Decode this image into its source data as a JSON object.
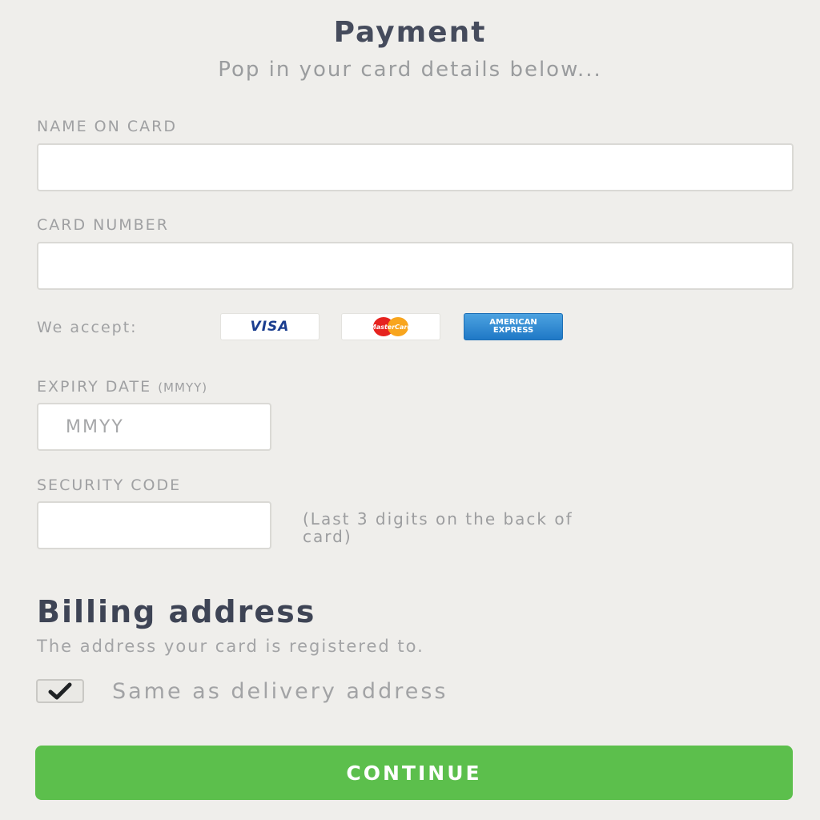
{
  "header": {
    "title": "Payment",
    "subtitle": "Pop in your card details below..."
  },
  "form": {
    "name_label": "NAME ON CARD",
    "name_value": "",
    "card_number_label": "CARD NUMBER",
    "card_number_value": "",
    "accept_label": "We accept:",
    "cards": {
      "visa": "VISA",
      "mastercard": "MasterCard",
      "amex_line1": "AMERICAN",
      "amex_line2": "EXPRESS"
    },
    "expiry_label": "EXPIRY DATE",
    "expiry_format": "(MMYY)",
    "expiry_placeholder": "MMYY",
    "security_label": "SECURITY CODE",
    "security_value": "",
    "security_hint": "(Last 3 digits on the back of card)"
  },
  "billing": {
    "title": "Billing address",
    "subtitle": "The address your card is registered to.",
    "same_as_delivery_label": "Same as delivery address",
    "same_as_delivery_checked": true
  },
  "actions": {
    "continue_label": "CONTINUE"
  },
  "colors": {
    "background": "#efeeeb",
    "accent_green": "#5cbf4c",
    "heading": "#454b5c",
    "muted_text": "#9fa0a2"
  }
}
